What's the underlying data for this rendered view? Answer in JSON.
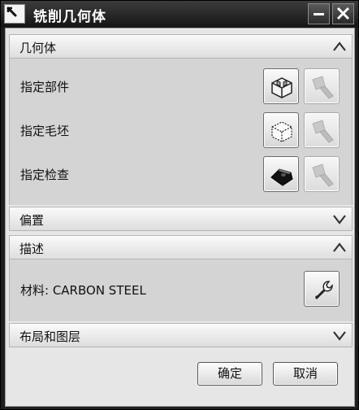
{
  "window": {
    "title": "铣削几何体"
  },
  "sections": {
    "geometry": {
      "title": "几何体",
      "rows": [
        {
          "label": "指定部件"
        },
        {
          "label": "指定毛坯"
        },
        {
          "label": "指定检查"
        }
      ]
    },
    "offset": {
      "title": "偏置"
    },
    "description": {
      "title": "描述",
      "material_label": "材料: CARBON STEEL"
    },
    "layout_layers": {
      "title": "布局和图层"
    }
  },
  "footer": {
    "ok_label": "确定",
    "cancel_label": "取消"
  }
}
